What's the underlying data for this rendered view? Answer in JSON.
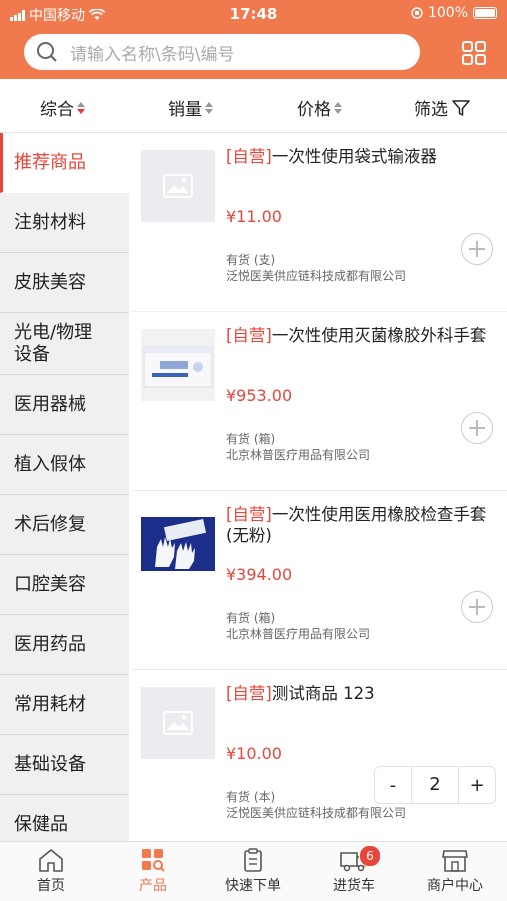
{
  "status_bar": {
    "carrier": "中国移动",
    "time": "17:48",
    "battery": "100%"
  },
  "search": {
    "placeholder": "请输入名称\\条码\\编号"
  },
  "sort": {
    "comprehensive": "综合",
    "sales": "销量",
    "price": "价格",
    "filter": "筛选"
  },
  "sidebar": {
    "items": [
      {
        "label": "推荐商品",
        "active": true
      },
      {
        "label": "注射材料"
      },
      {
        "label": "皮肤美容"
      },
      {
        "label": "光电/物理设备"
      },
      {
        "label": "医用器械"
      },
      {
        "label": "植入假体"
      },
      {
        "label": "术后修复"
      },
      {
        "label": "口腔美容"
      },
      {
        "label": "医用药品"
      },
      {
        "label": "常用耗材"
      },
      {
        "label": "基础设备"
      },
      {
        "label": "保健品"
      }
    ]
  },
  "products": [
    {
      "tag": "[自营]",
      "name": "一次性使用袋式输液器",
      "price": "¥11.00",
      "stock": "有货 (支)",
      "seller": "泛悦医美供应链科技成都有限公司"
    },
    {
      "tag": "[自营]",
      "name": "一次性使用灭菌橡胶外科手套",
      "price": "¥953.00",
      "stock": "有货 (箱)",
      "seller": "北京林普医疗用品有限公司"
    },
    {
      "tag": "[自营]",
      "name": "一次性使用医用橡胶检查手套 (无粉)",
      "price": "¥394.00",
      "stock": "有货 (箱)",
      "seller": "北京林普医疗用品有限公司"
    },
    {
      "tag": "[自营]",
      "name": "测试商品 123",
      "price": "¥10.00",
      "stock": "有货 (本)",
      "seller": "泛悦医美供应链科技成都有限公司"
    }
  ],
  "stepper": {
    "minus": "-",
    "quantity": "2",
    "plus": "+"
  },
  "tabbar": {
    "home": "首页",
    "products": "产品",
    "quick_order": "快速下单",
    "cart": "进货车",
    "cart_badge": "6",
    "merchant": "商户中心"
  },
  "colors": {
    "accent": "#f07a4e",
    "price_red": "#e8463a"
  }
}
